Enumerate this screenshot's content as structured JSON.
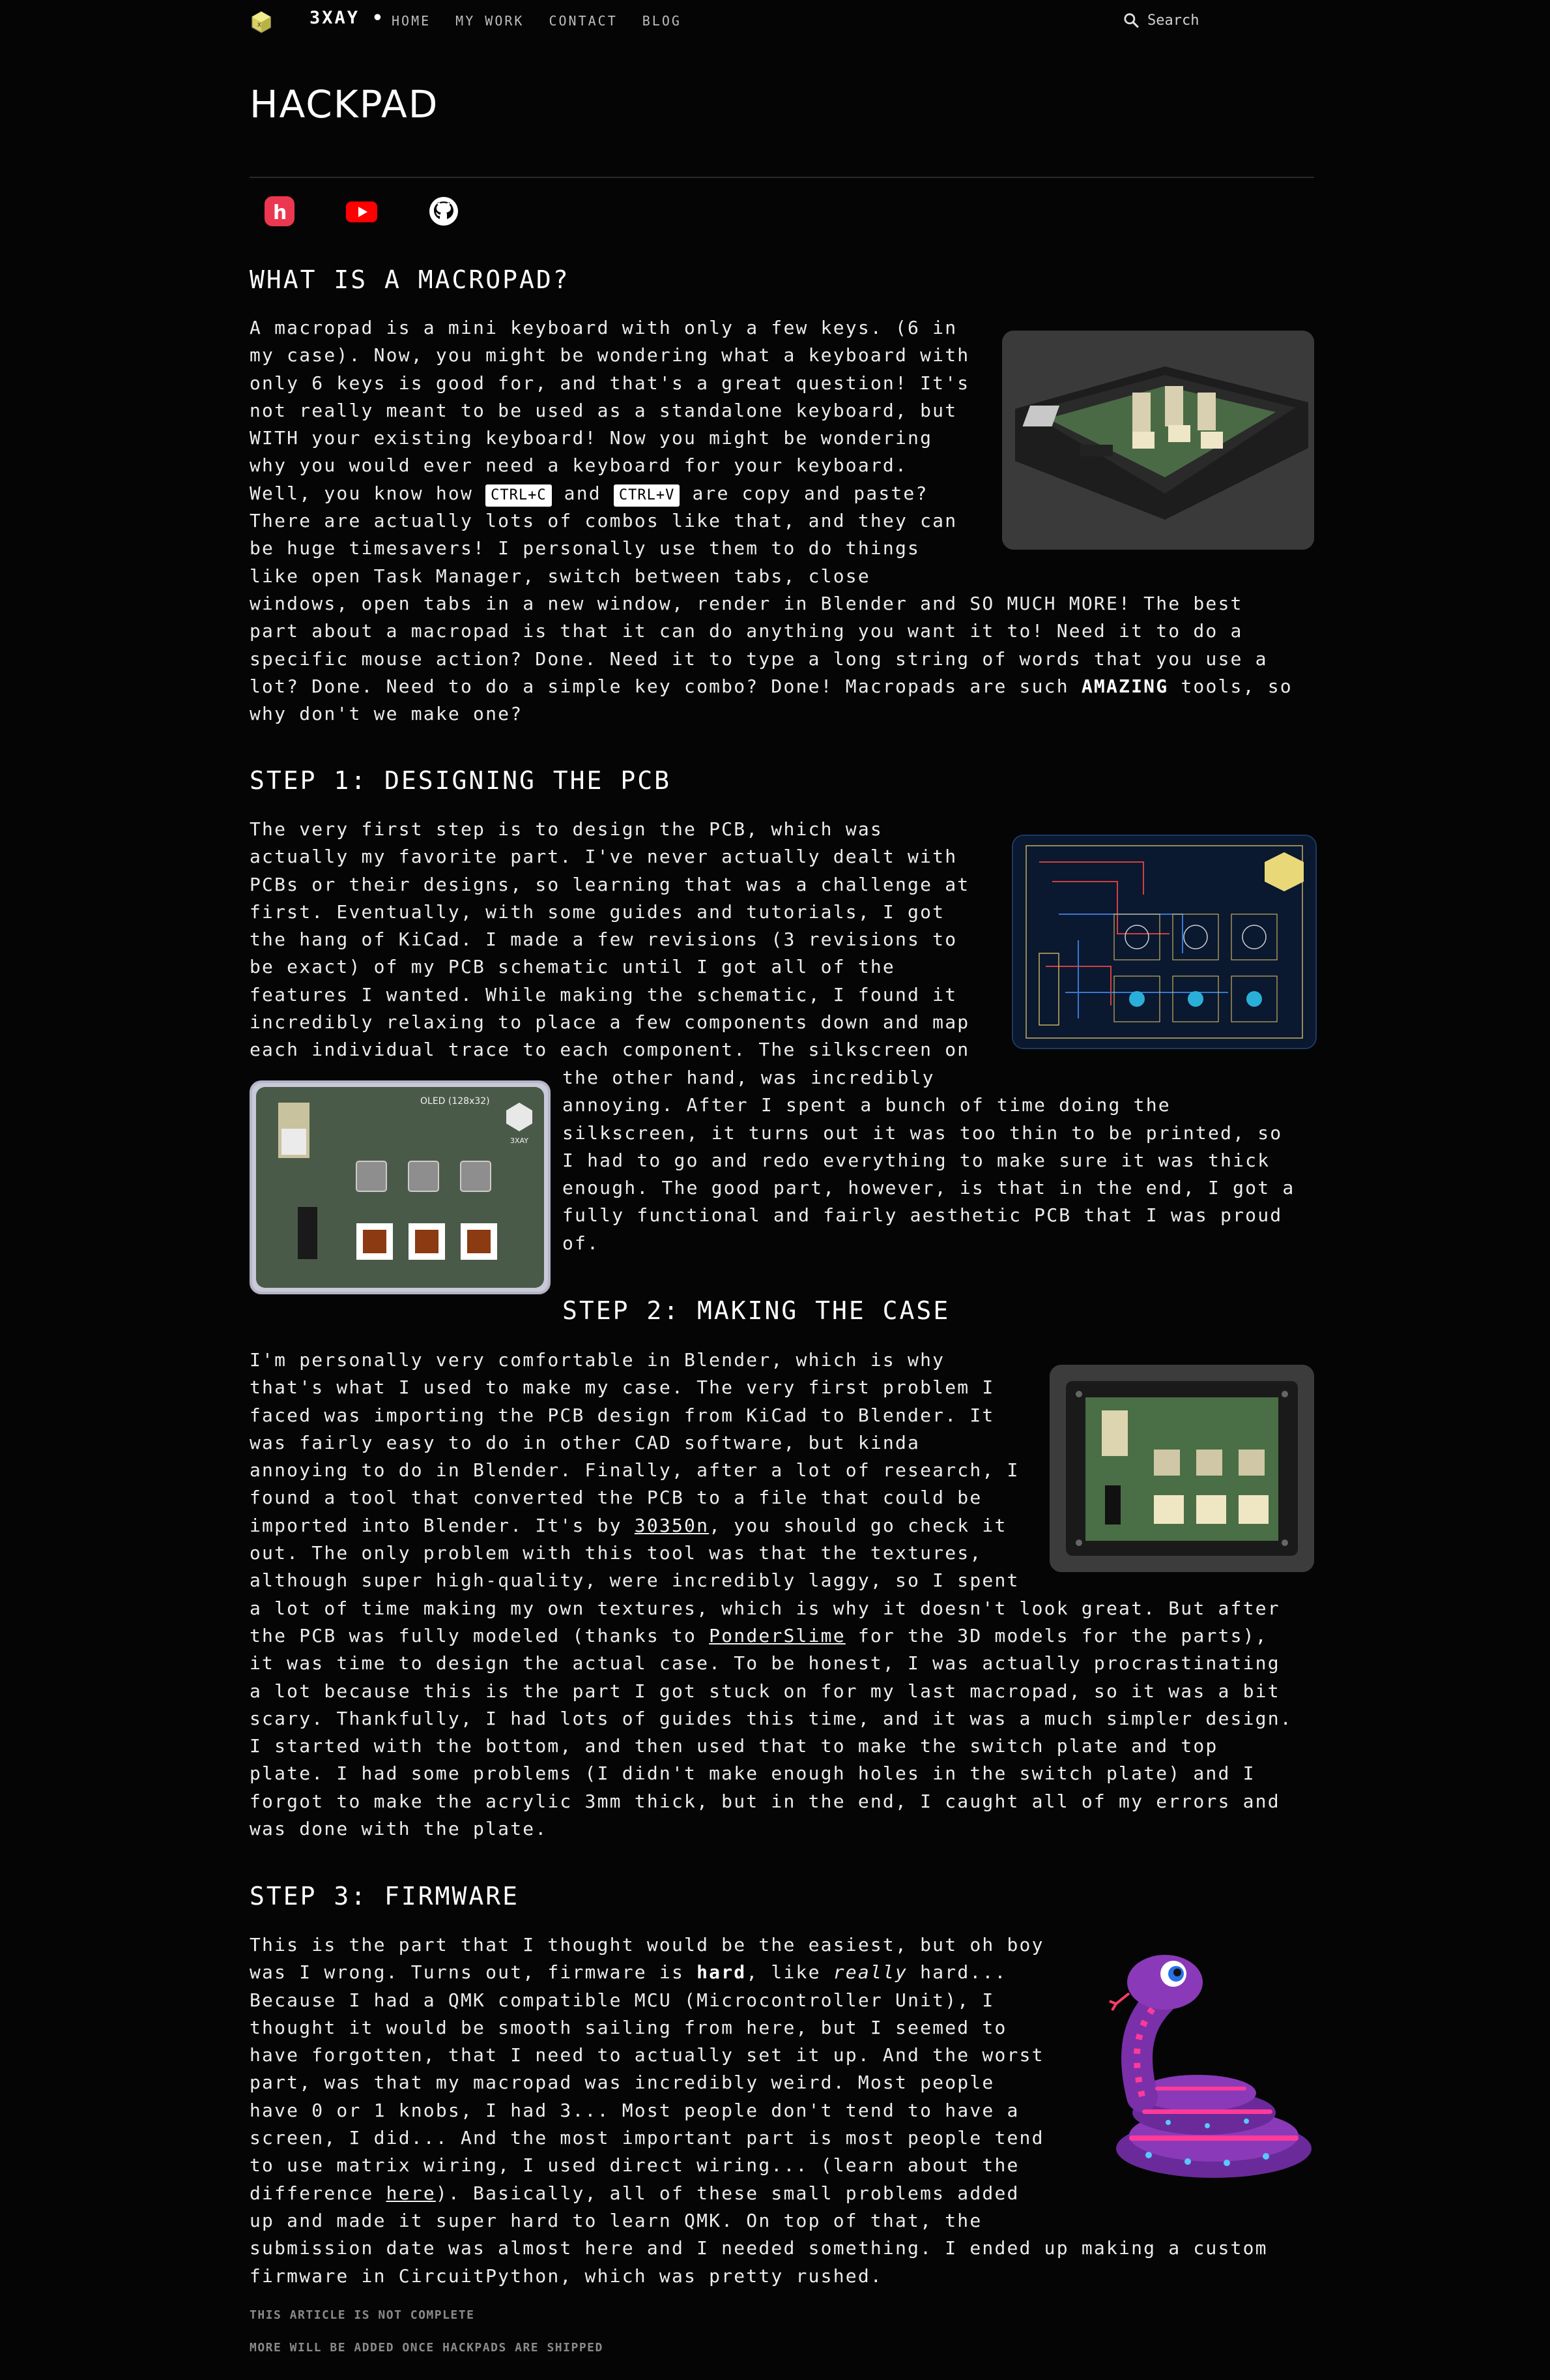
{
  "nav": {
    "brand": "3XAY •",
    "links": [
      "HOME",
      "MY WORK",
      "CONTACT",
      "BLOG"
    ],
    "search_placeholder": "Search"
  },
  "page": {
    "title": "HACKPAD"
  },
  "socials": [
    {
      "name": "hackclub-icon",
      "color": "#ec3750"
    },
    {
      "name": "youtube-icon",
      "color": "#ff0000"
    },
    {
      "name": "github-icon",
      "color": "#ffffff"
    }
  ],
  "sections": {
    "macropad": {
      "heading": "WHAT IS A MACROPAD?",
      "lines_wrap": [
        "A macropad is a mini keyboard with only a few keys. (6 in",
        "my case). Now, you might be wondering what a keyboard with",
        "only 6 keys is good for, and that's a great question! It's",
        "not really meant to be used as a standalone keyboard, but",
        "WITH your existing keyboard! Now you might be wondering",
        "why you would ever need a keyboard for your keyboard."
      ],
      "line_kbd_a": "Well, you know how",
      "kbd1": "CTRL+C",
      "line_kbd_b": "and",
      "kbd2": "CTRL+V",
      "line_kbd_c": "are copy and paste?",
      "lines_wrap2": [
        "There are actually lots of combos like that, and they can",
        "be huge timesavers! I personally use them to do things",
        "like open Task Manager, switch between tabs, close"
      ],
      "lines_full": [
        "windows, open tabs in a new window, render in Blender and SO MUCH MORE! The best",
        "part about a macropad is that it can do anything you want it to! Need it to do a",
        "specific mouse action? Done. Need it to type a long string of words that you use a"
      ],
      "last_a": "lot? Done. Need to do a simple key combo? Done! Macropads are such",
      "last_bold": "AMAZING",
      "last_b": "tools, so",
      "last_line": "why don't we make one?"
    },
    "step1": {
      "heading": "STEP 1: DESIGNING THE PCB",
      "lines_left": [
        "The very first step is to design the PCB, which was",
        "actually my favorite part. I've never actually dealt with",
        "PCBs or their designs, so learning that was a challenge at",
        "first. Eventually, with some guides and tutorials, I got",
        "the hang of KiCad. I made a few revisions (3 revisions to",
        "be exact) of my PCB schematic until I got all of the",
        "features I wanted. While making the schematic, I found it",
        "incredibly relaxing to place a few components down and map",
        "each individual trace to each component. The silkscreen on"
      ],
      "lines_right": [
        "the other hand, was incredibly",
        "annoying. After I spent a bunch of time doing the",
        "silkscreen, it turns out it was too thin to be printed, so",
        "I had to go and redo everything to make sure it was thick",
        "enough. The good part, however, is that in the end, I got a",
        "fully functional and fairly aesthetic PCB that I was proud",
        "of."
      ],
      "pcb_label_oled": "OLED (128x32)",
      "pcb_label_brand": "3XAY"
    },
    "step2": {
      "heading": "STEP 2: MAKING THE CASE",
      "lines_wrap": [
        "I'm personally very comfortable in Blender, which is why",
        "that's what I used to make my case. The very first problem I",
        "faced was importing the PCB design from KiCad to Blender. It",
        "was fairly easy to do in other CAD software, but kinda",
        "annoying to do in Blender. Finally, after a lot of research, I",
        "found a tool that converted the PCB to a file that could be"
      ],
      "link_line_a": "imported into Blender. It's by",
      "link1": "30350n",
      "link_line_b": ", you should go check it",
      "lines_wrap2": [
        "out. The only problem with this tool was that the textures,",
        "although super high-quality, were incredibly laggy, so I spent",
        "a lot of time making my own textures, which is why it doesn't look great. But after"
      ],
      "link2_line_a": "the PCB was fully modeled (thanks to",
      "link2": "PonderSlime",
      "link2_line_b": "for the 3D models for the parts),",
      "lines_full": [
        "it was time to design the actual case. To be honest, I was actually procrastinating",
        "a lot because this is the part I got stuck on for my last macropad, so it was a bit",
        "scary. Thankfully, I had lots of guides this time, and it was a much simpler design.",
        "I started with the bottom, and then used that to make the switch plate and top",
        "plate. I had some problems (I didn't make enough holes in the switch plate) and I",
        "forgot to make the acrylic 3mm thick, but in the end, I caught all of my errors and",
        "was done with the plate."
      ]
    },
    "step3": {
      "heading": "STEP 3: FIRMWARE",
      "line1": "This is the part that I thought would be the easiest, but oh boy",
      "line2_a": "was I wrong. Turns out, firmware is",
      "line2_bold": "hard",
      "line2_b": ", like",
      "line2_italic": "really",
      "line2_c": "hard...",
      "lines_wrap": [
        "Because I had a QMK compatible MCU (Microcontroller Unit), I",
        "thought it would be smooth sailing from here, but I seemed to",
        "have forgotten, that I need to actually set it up. And the worst",
        "part, was that my macropad was incredibly weird. Most people",
        "have 0 or 1 knobs, I had 3... Most people don't tend to have a",
        "screen, I did... And the most important part is most people tend",
        "to use matrix wiring, I used direct wiring... (learn about the"
      ],
      "link_line_a": "difference",
      "link": "here",
      "link_line_b": "). Basically, all of these small problems added",
      "lines_after": [
        "up and made it super hard to learn QMK. On top of that, the",
        "submission date was almost here and I needed something. I ended up making a custom",
        "firmware in CircuitPython, which was pretty rushed."
      ]
    }
  },
  "footer": {
    "note1": "THIS ARTICLE IS NOT COMPLETE",
    "note2": "MORE WILL BE ADDED ONCE HACKPADS ARE SHIPPED"
  }
}
